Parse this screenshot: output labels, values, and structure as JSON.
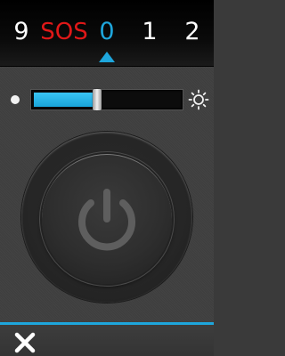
{
  "mode_selector": {
    "items": [
      "9",
      "SOS",
      "0",
      "1",
      "2"
    ],
    "selected_index": 2,
    "colors": {
      "default": "#ffffff",
      "sos": "#e01818",
      "selected": "#1ea6dc"
    }
  },
  "brightness": {
    "level": 0.43,
    "min_icon": "dim-dot-icon",
    "max_icon": "sun-icon",
    "accent_color": "#1ea6dc"
  },
  "power": {
    "icon": "power-icon"
  },
  "bottom_bar": {
    "close_icon": "close-icon",
    "accent_color": "#1ea6dc"
  }
}
